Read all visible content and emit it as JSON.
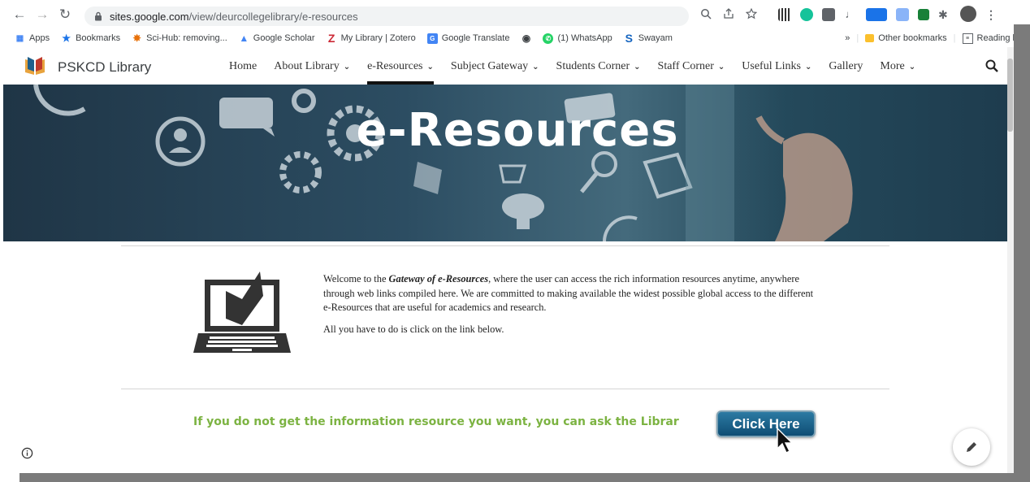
{
  "browser": {
    "url_host": "sites.google.com",
    "url_path": "/view/deurcollegelibrary/e-resources",
    "bookmarks": [
      {
        "label": "Apps",
        "icon": "apps-grid-icon",
        "color": "#4285f4"
      },
      {
        "label": "Bookmarks",
        "icon": "star-icon",
        "color": "#1a73e8"
      },
      {
        "label": "Sci-Hub: removing...",
        "icon": "scihub-icon",
        "color": "#e8710a"
      },
      {
        "label": "Google Scholar",
        "icon": "scholar-icon",
        "color": "#4285f4"
      },
      {
        "label": "My Library | Zotero",
        "icon": "zotero-icon",
        "color": "#cc2936"
      },
      {
        "label": "Google Translate",
        "icon": "translate-icon",
        "color": "#4285f4"
      },
      {
        "label": "",
        "icon": "globe-icon",
        "color": "#3c4043"
      },
      {
        "label": "(1) WhatsApp",
        "icon": "whatsapp-icon",
        "color": "#25d366"
      },
      {
        "label": "Swayam",
        "icon": "swayam-icon",
        "color": "#1565c0"
      }
    ],
    "more_chevron": "»",
    "other_bookmarks": "Other bookmarks",
    "reading_list": "Reading list"
  },
  "site": {
    "title": "PSKCD Library",
    "nav": [
      {
        "label": "Home",
        "has_menu": false
      },
      {
        "label": "About Library",
        "has_menu": true
      },
      {
        "label": "e-Resources",
        "has_menu": true,
        "active": true
      },
      {
        "label": "Subject Gateway",
        "has_menu": true
      },
      {
        "label": "Students Corner",
        "has_menu": true
      },
      {
        "label": "Staff Corner",
        "has_menu": true
      },
      {
        "label": "Useful Links",
        "has_menu": true
      },
      {
        "label": "Gallery",
        "has_menu": false
      },
      {
        "label": "More",
        "has_menu": true
      }
    ]
  },
  "banner": {
    "title": "e-Resources"
  },
  "intro": {
    "p1_pre": "Welcome to the ",
    "p1_em": "Gateway of e-Resources",
    "p1_post": ", where the user can access the rich information resources anytime, anywhere through web links compiled here. We are committed to making available the widest possible global access to the different e-Resources that are useful for academics and research.",
    "p2": "All you have to do is click on the link below."
  },
  "ask": {
    "text": "If you do not get the information resource you want, you can ask the Librar",
    "button": "Click Here"
  },
  "colors": {
    "ask_text": "#7cb342",
    "button": "#0e4d74",
    "banner": "#2c4d62"
  }
}
